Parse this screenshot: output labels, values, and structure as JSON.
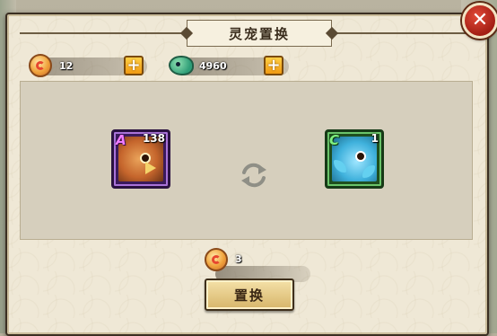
{
  "dialog": {
    "title": "灵宠置换",
    "close_label": "✕"
  },
  "currencies": {
    "gold": {
      "icon": "gold-coin-icon",
      "value": "12"
    },
    "jade": {
      "icon": "green-bean-icon",
      "value": "4960"
    }
  },
  "pets": {
    "source": {
      "rank": "A",
      "level": "138",
      "icon": "eagle-pet-icon"
    },
    "target": {
      "rank": "C",
      "level": "1",
      "icon": "fish-pet-icon"
    }
  },
  "swap_icon": "swap-arrows-icon",
  "cost": {
    "icon": "gold-coin-icon",
    "value": "3"
  },
  "confirm_button": {
    "label": "置换"
  },
  "colors": {
    "frame": "#3b2f22",
    "parchment": "#efe8d6",
    "rank_a": "#f07cff",
    "rank_c": "#7ff07f",
    "close": "#c42a1c",
    "plus": "#f7b42a"
  }
}
